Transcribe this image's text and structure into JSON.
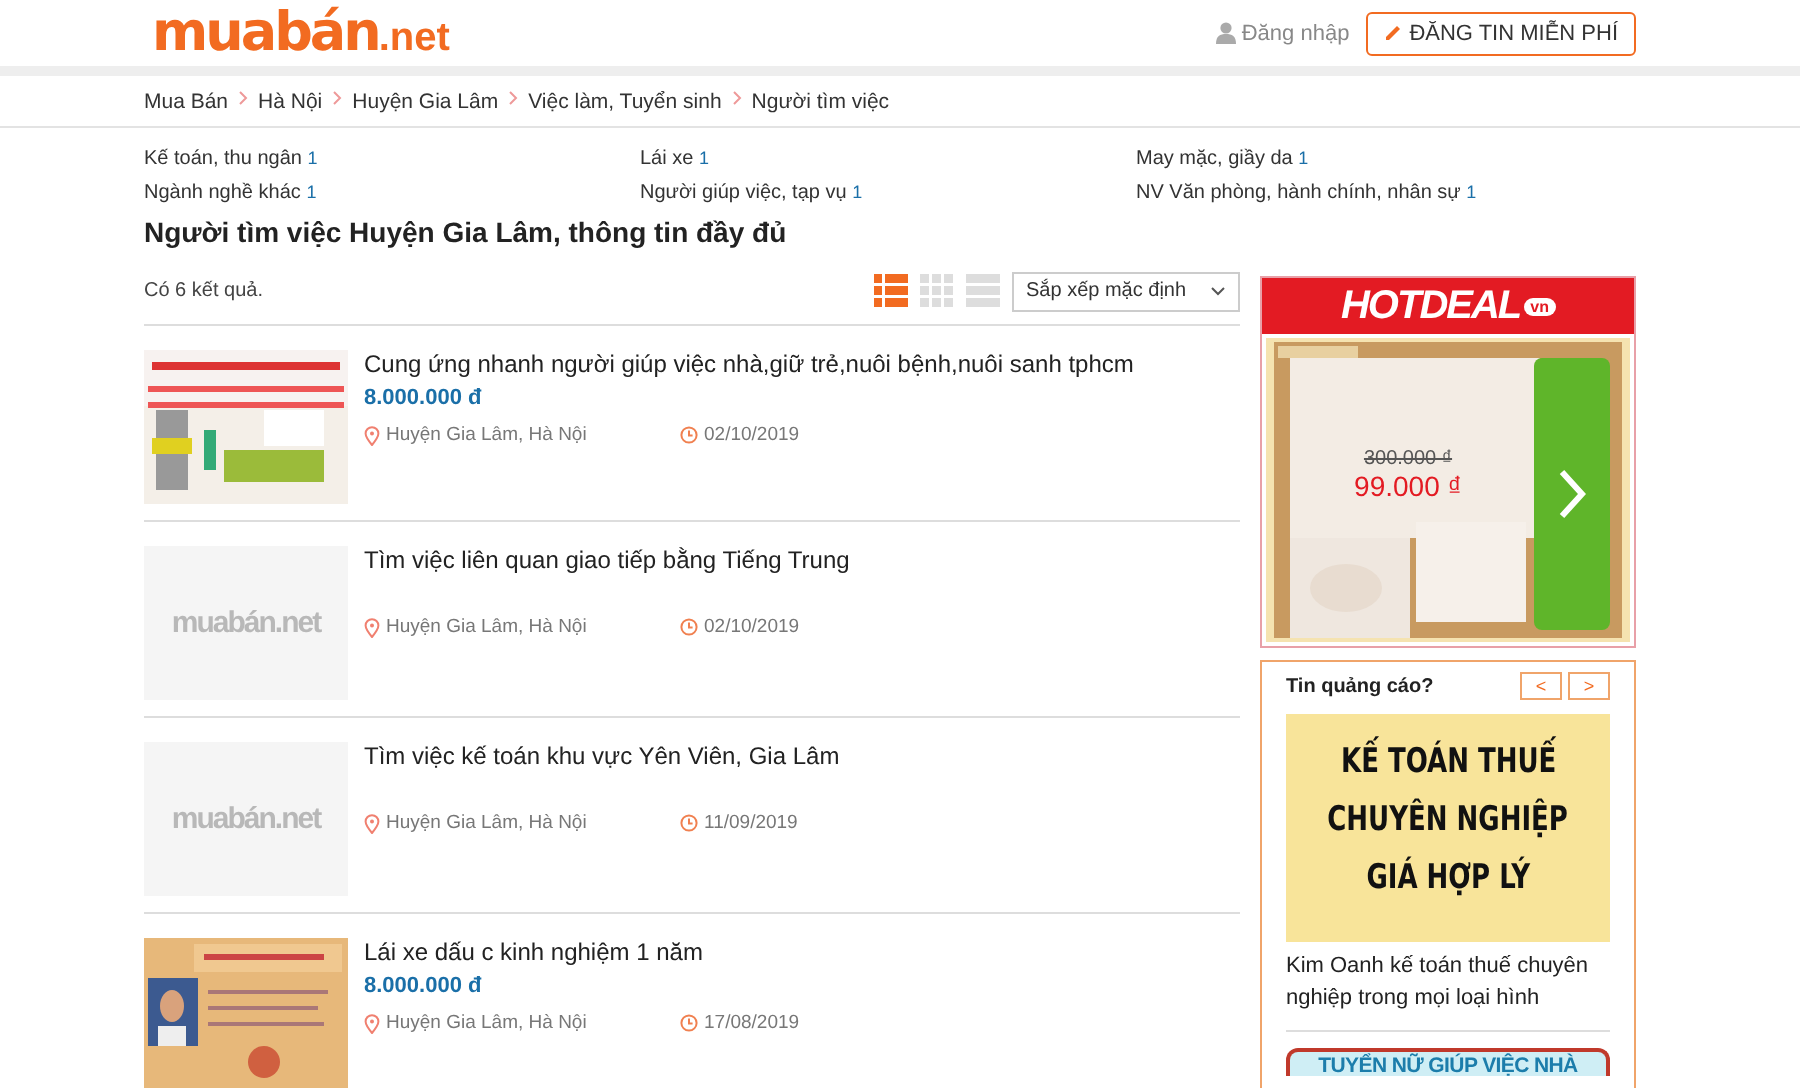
{
  "header": {
    "logo": {
      "main": "muabán",
      "suffix": ".net"
    },
    "login": "Đăng nhập",
    "post_button": "ĐĂNG TIN MIỄN PHÍ"
  },
  "breadcrumb": [
    "Mua Bán",
    "Hà Nội",
    "Huyện Gia Lâm",
    "Việc làm, Tuyển sinh",
    "Người tìm việc"
  ],
  "categories": [
    {
      "label": "Kế toán, thu ngân",
      "count": "1"
    },
    {
      "label": "Lái xe",
      "count": "1"
    },
    {
      "label": "May mặc, giầy da",
      "count": "1"
    },
    {
      "label": "Ngành nghề khác",
      "count": "1"
    },
    {
      "label": "Người giúp việc, tạp vụ",
      "count": "1"
    },
    {
      "label": "NV Văn phòng, hành chính, nhân sự",
      "count": "1"
    }
  ],
  "page_title": "Người tìm việc Huyện Gia Lâm, thông tin đầy đủ",
  "result_count": "Có 6 kết quả.",
  "view_modes": [
    {
      "kind": "list",
      "selected": true
    },
    {
      "kind": "grid",
      "selected": false
    },
    {
      "kind": "rows",
      "selected": false
    }
  ],
  "sort": {
    "value": "Sắp xếp mặc định"
  },
  "listings": [
    {
      "title": "Cung ứng nhanh người giúp việc nhà,giữ trẻ,nuôi bệnh,nuôi sanh tphcm",
      "price": "8.000.000 đ",
      "location": "Huyện Gia Lâm, Hà Nội",
      "date": "02/10/2019"
    },
    {
      "thumb": {
        "kind": "placeholder",
        "text": "muabán.net"
      },
      "title": "Tìm việc liên quan giao tiếp bằng Tiếng Trung",
      "location": "Huyện Gia Lâm, Hà Nội",
      "date": "02/10/2019"
    },
    {
      "thumb": {
        "kind": "placeholder",
        "text": "muabán.net"
      },
      "title": "Tìm việc kế toán khu vực Yên Viên, Gia Lâm",
      "location": "Huyện Gia Lâm, Hà Nội",
      "date": "11/09/2019"
    },
    {
      "title": "Lái xe dấu c kinh nghiệm 1 năm",
      "price": "8.000.000 đ",
      "location": "Huyện Gia Lâm, Hà Nội",
      "date": "17/08/2019"
    }
  ],
  "ad_banner": {
    "brand": "HOTDEAL",
    "brand_suffix": "vn",
    "old_price": "300.000 ₫",
    "new_price": "99.000 ₫"
  },
  "ad_box": {
    "title": "Tin quảng cáo?",
    "prev": "<",
    "next": ">",
    "banner_lines": [
      "KẾ TOÁN THUẾ",
      "CHUYÊN NGHIỆP",
      "GIÁ HỢP LÝ"
    ],
    "caption": "Kim Oanh kế toán thuế chuyên nghiệp trong mọi loại hình",
    "next_banner": "TUYỂN NỮ GIÚP VIỆC NHÀ"
  }
}
